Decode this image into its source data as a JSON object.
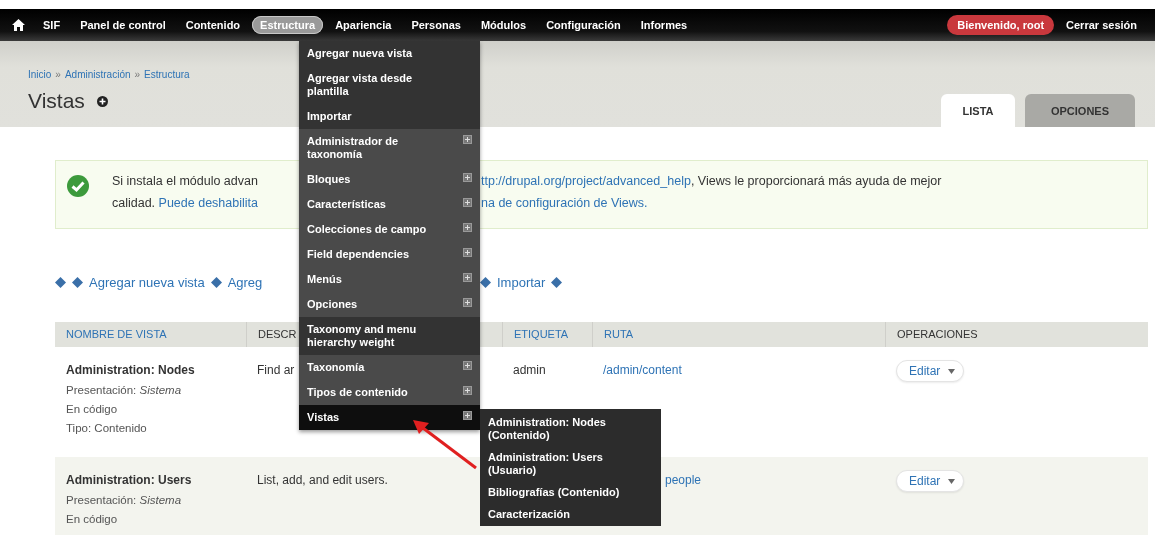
{
  "toolbar": {
    "items": [
      {
        "label": "SIF",
        "selected": false
      },
      {
        "label": "Panel de control",
        "selected": false
      },
      {
        "label": "Contenido",
        "selected": false
      },
      {
        "label": "Estructura",
        "selected": true
      },
      {
        "label": "Apariencia",
        "selected": false
      },
      {
        "label": "Personas",
        "selected": false
      },
      {
        "label": "Módulos",
        "selected": false
      },
      {
        "label": "Configuración",
        "selected": false
      },
      {
        "label": "Informes",
        "selected": false
      }
    ],
    "user": "Bienvenido, root",
    "logout": "Cerrar sesión"
  },
  "breadcrumb": [
    {
      "kind": "link",
      "text": "Inicio"
    },
    {
      "kind": "sep",
      "text": "»"
    },
    {
      "kind": "link",
      "text": "Administración"
    },
    {
      "kind": "sep",
      "text": "»"
    },
    {
      "kind": "link",
      "text": "Estructura"
    }
  ],
  "page_title": "Vistas",
  "tabs": [
    {
      "label": "LISTA",
      "selected": true
    },
    {
      "label": "OPCIONES",
      "selected": false
    }
  ],
  "message": {
    "lines": [
      {
        "before": [
          {
            "kind": "text",
            "text": "Si instala el módulo advan"
          }
        ],
        "after": [
          {
            "kind": "link",
            "text": "ttp://drupal.org/project/advanced_help"
          },
          {
            "kind": "text",
            "text": ", Views le proporcionará más ayuda de mejor"
          }
        ]
      },
      {
        "before": [
          {
            "kind": "text",
            "text": "calidad. "
          },
          {
            "kind": "link",
            "text": "Puede deshabilita"
          }
        ],
        "after": [
          {
            "kind": "link",
            "text": "na de configuración de Views."
          }
        ]
      }
    ]
  },
  "actions": {
    "before": [
      {
        "kind": "icon"
      },
      {
        "kind": "icon"
      },
      {
        "kind": "link",
        "text": "Agregar nueva vista"
      },
      {
        "kind": "icon"
      },
      {
        "kind": "link",
        "text": "Agreg"
      }
    ],
    "after": [
      {
        "kind": "icon"
      },
      {
        "kind": "link",
        "text": "Importar"
      },
      {
        "kind": "icon"
      }
    ]
  },
  "table": {
    "columns": [
      {
        "label": "NOMBRE DE VISTA",
        "link": true
      },
      {
        "label": "DESCR",
        "link": false
      },
      {
        "label": "ETIQUETA",
        "link": true
      },
      {
        "label": "RUTA",
        "link": true
      },
      {
        "label": "OPERACIONES",
        "link": false
      }
    ],
    "rows": [
      {
        "name": "Administration: Nodes",
        "meta": [
          "Presentación: *Sistema*",
          "En código",
          "Tipo: Contenido"
        ],
        "description": "Find ar",
        "tag": "admin",
        "path": "/admin/content",
        "operation": "Editar"
      },
      {
        "name": "Administration: Users",
        "meta": [
          "Presentación: *Sistema*",
          "En código"
        ],
        "description": "List, add, and edit users.",
        "path": "people",
        "operation": "Editar"
      }
    ]
  },
  "menu": {
    "items": [
      {
        "label": "Agregar nueva vista",
        "has_children": false,
        "selected": false
      },
      {
        "label": "Agregar vista desde plantilla",
        "has_children": false,
        "selected": false
      },
      {
        "label": "Importar",
        "has_children": false,
        "selected": false
      },
      {
        "label": "Administrador de taxonomía",
        "has_children": true,
        "selected": false
      },
      {
        "label": "Bloques",
        "has_children": true,
        "selected": false
      },
      {
        "label": "Características",
        "has_children": true,
        "selected": false
      },
      {
        "label": "Colecciones de campo",
        "has_children": true,
        "selected": false
      },
      {
        "label": "Field dependencies",
        "has_children": true,
        "selected": false
      },
      {
        "label": "Menús",
        "has_children": true,
        "selected": false
      },
      {
        "label": "Opciones",
        "has_children": true,
        "selected": false
      },
      {
        "label": "Taxonomy and menu hierarchy weight",
        "has_children": false,
        "selected": false
      },
      {
        "label": "Taxonomía",
        "has_children": true,
        "selected": false
      },
      {
        "label": "Tipos de contenido",
        "has_children": true,
        "selected": false
      },
      {
        "label": "Vistas",
        "has_children": true,
        "selected": true
      }
    ]
  },
  "submenu": {
    "items": [
      "Administration: Nodes (Contenido)",
      "Administration: Users (Usuario)",
      "Bibliografías (Contenido)",
      "Caracterización"
    ]
  }
}
